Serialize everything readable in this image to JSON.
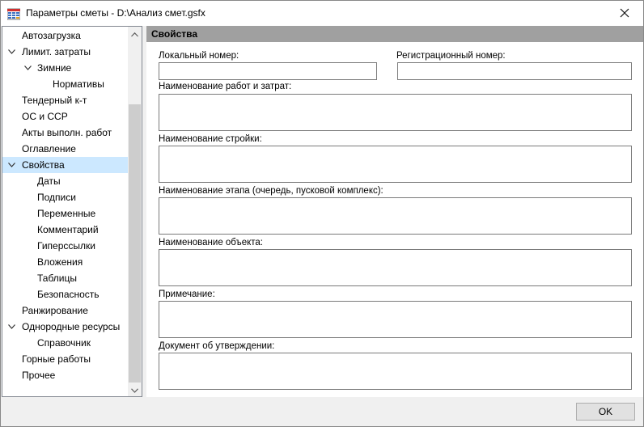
{
  "window": {
    "title": "Параметры сметы - D:\\Анализ смет.gsfx"
  },
  "tree": {
    "items": [
      {
        "label": "Автозагрузка"
      },
      {
        "label": "Лимит. затраты",
        "expanded": true
      },
      {
        "label": "Зимние",
        "expanded": true
      },
      {
        "label": "Нормативы"
      },
      {
        "label": "Тендерный к-т"
      },
      {
        "label": "ОС и ССР"
      },
      {
        "label": "Акты выполн. работ"
      },
      {
        "label": "Оглавление"
      },
      {
        "label": "Свойства",
        "expanded": true,
        "selected": true
      },
      {
        "label": "Даты"
      },
      {
        "label": "Подписи"
      },
      {
        "label": "Переменные"
      },
      {
        "label": "Комментарий"
      },
      {
        "label": "Гиперссылки"
      },
      {
        "label": "Вложения"
      },
      {
        "label": "Таблицы"
      },
      {
        "label": "Безопасность"
      },
      {
        "label": "Ранжирование"
      },
      {
        "label": "Однородные ресурсы",
        "expanded": true
      },
      {
        "label": "Справочник"
      },
      {
        "label": "Горные работы"
      },
      {
        "label": "Прочее"
      }
    ]
  },
  "properties": {
    "header": "Свойства",
    "local_number_label": "Локальный номер:",
    "local_number_value": "",
    "registration_number_label": "Регистрационный номер:",
    "registration_number_value": "",
    "works_name_label": "Наименование работ и затрат:",
    "works_name_value": "",
    "construction_name_label": "Наименование стройки:",
    "construction_name_value": "",
    "stage_name_label": "Наименование этапа (очередь, пусковой комплекс):",
    "stage_name_value": "",
    "object_name_label": "Наименование объекта:",
    "object_name_value": "",
    "note_label": "Примечание:",
    "note_value": "",
    "approval_doc_label": "Документ об утверждении:",
    "approval_doc_value": ""
  },
  "footer": {
    "ok_label": "OK"
  },
  "colors": {
    "selection": "#cce8ff",
    "header_bg": "#a0a0a0",
    "window_bg": "#f0f0f0"
  }
}
